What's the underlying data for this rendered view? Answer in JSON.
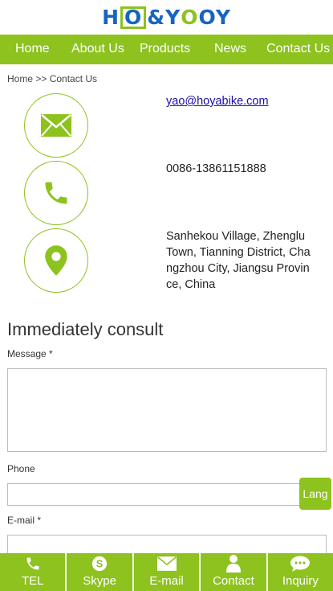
{
  "brand": {
    "logo_left": "H",
    "logo_box": "O",
    "logo_mid": "&Y",
    "logo_accent": "O",
    "logo_right": "OY",
    "primary_color": "#8dc21f",
    "logo_color": "#1565c0"
  },
  "nav": {
    "items": [
      {
        "label": "Home"
      },
      {
        "label": "About Us"
      },
      {
        "label": "Products"
      },
      {
        "label": "News"
      },
      {
        "label": "Contact Us"
      }
    ]
  },
  "breadcrumb": {
    "text": "Home >> Contact Us"
  },
  "contact": {
    "email": "yao@hoyabike.com",
    "phone": "0086-13861151888",
    "address": "Sanhekou Village, Zhenglu Town, Tianning District, Changzhou City, Jiangsu Province, China",
    "icons": [
      "envelope-icon",
      "phone-icon",
      "location-pin-icon"
    ]
  },
  "form": {
    "title": "Immediately consult",
    "message_label": "Message *",
    "message_value": "",
    "phone_label": "Phone",
    "phone_value": "",
    "email_label": "E-mail *",
    "email_value": ""
  },
  "lang_button": {
    "label": "Lang"
  },
  "bottom_bar": {
    "items": [
      {
        "label": "TEL",
        "icon": "phone-icon"
      },
      {
        "label": "Skype",
        "icon": "skype-icon"
      },
      {
        "label": "E-mail",
        "icon": "envelope-icon"
      },
      {
        "label": "Contact",
        "icon": "person-icon"
      },
      {
        "label": "Inquiry",
        "icon": "chat-bubble-icon"
      }
    ]
  }
}
